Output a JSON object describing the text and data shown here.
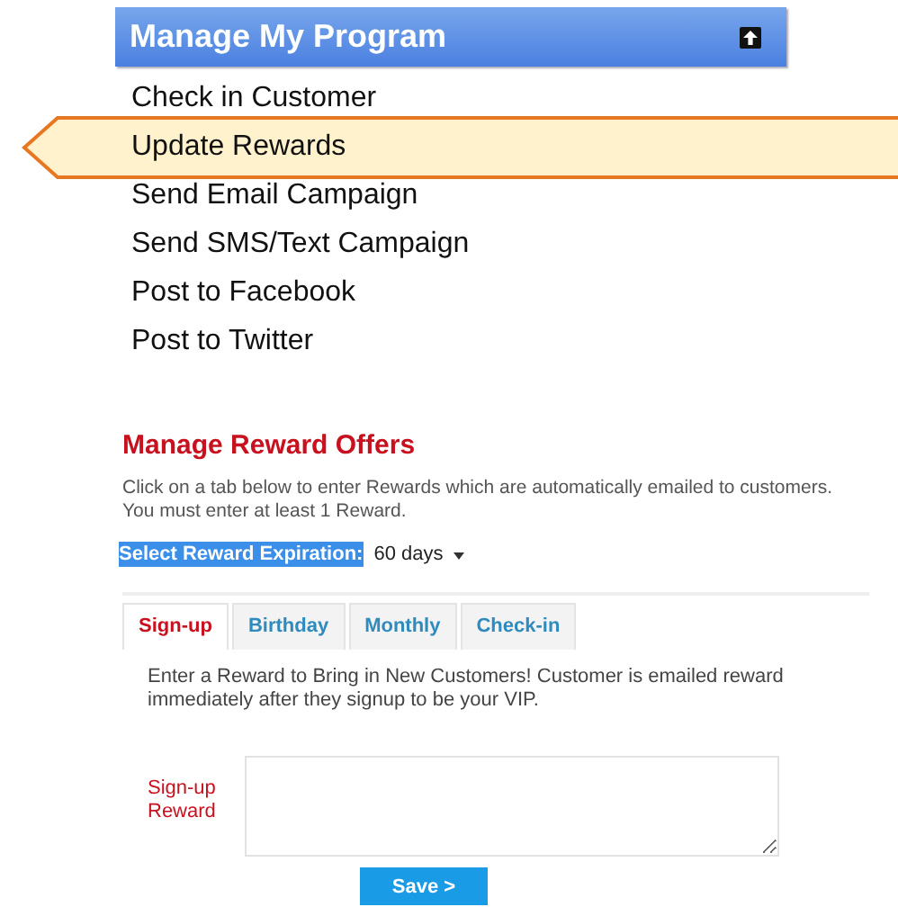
{
  "panel": {
    "title": "Manage My Program"
  },
  "menu": [
    {
      "label": "Check in Customer",
      "selected": false
    },
    {
      "label": "Update Rewards",
      "selected": true
    },
    {
      "label": "Send Email Campaign",
      "selected": false
    },
    {
      "label": "Send SMS/Text Campaign",
      "selected": false
    },
    {
      "label": "Post to Facebook",
      "selected": false
    },
    {
      "label": "Post to Twitter",
      "selected": false
    }
  ],
  "offers": {
    "heading": "Manage Reward Offers",
    "description": "Click on a tab below to enter Rewards which are automatically emailed to customers. You must enter at least 1 Reward.",
    "expiration_label": "Select Reward Expiration:",
    "expiration_value": "60 days",
    "tabs": [
      {
        "label": "Sign-up",
        "selected": true
      },
      {
        "label": "Birthday",
        "selected": false
      },
      {
        "label": "Monthly",
        "selected": false
      },
      {
        "label": "Check-in",
        "selected": false
      }
    ],
    "tab_text": "Enter a Reward to Bring in New Customers! Customer is emailed reward immediately after they signup to be your VIP.",
    "field_label": "Sign-up Reward",
    "button": "Save >"
  }
}
